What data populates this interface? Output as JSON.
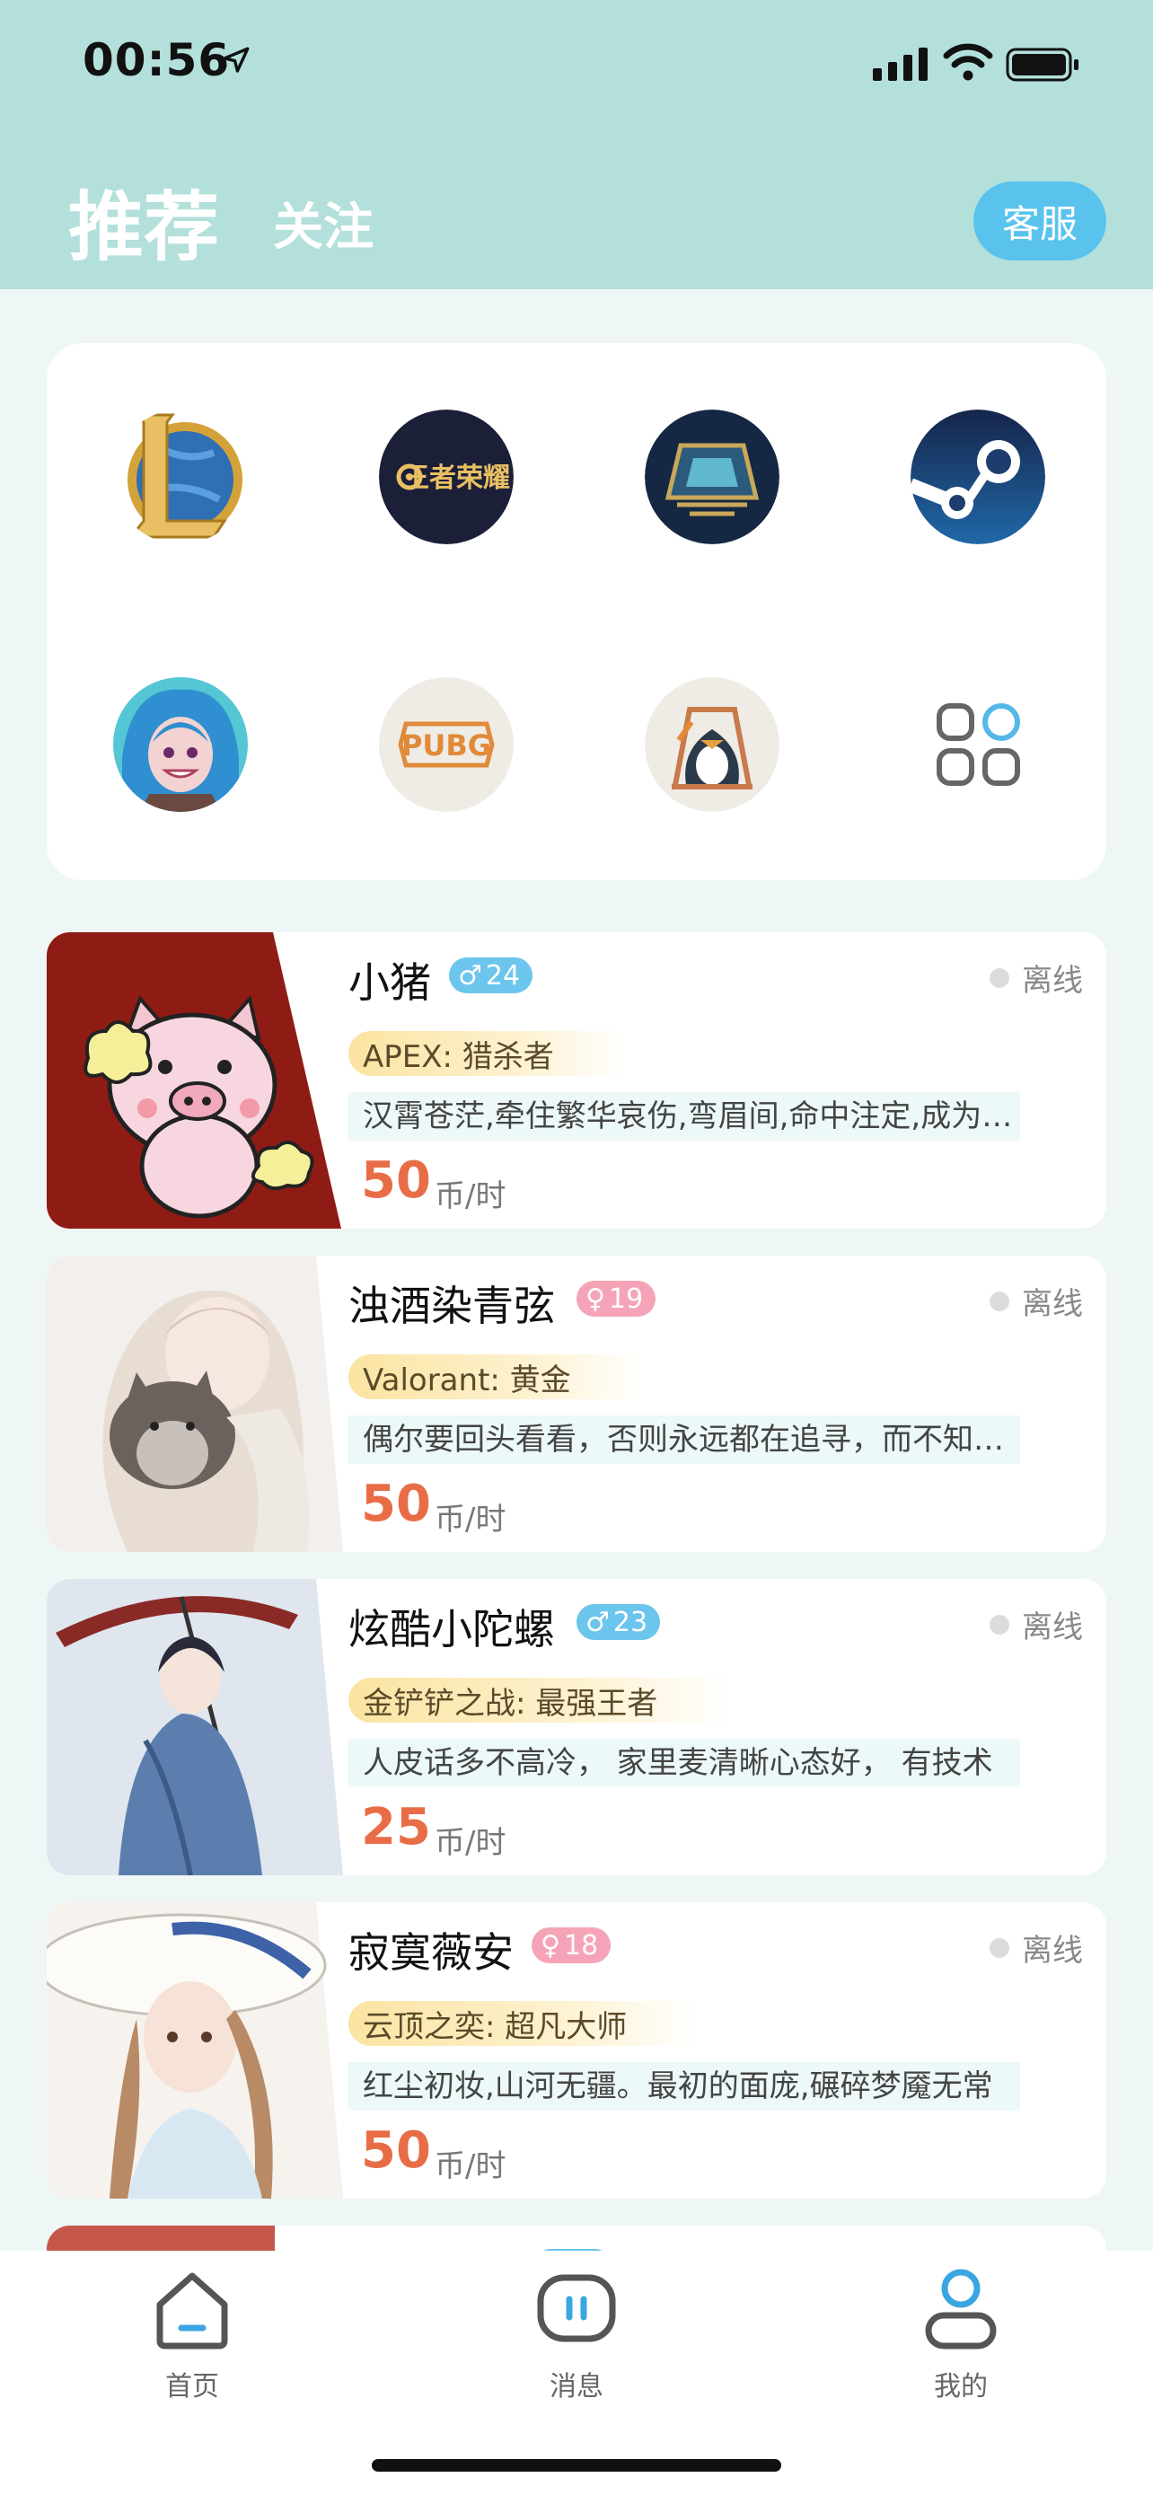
{
  "status_bar": {
    "time": "00:56"
  },
  "header": {
    "tab_recommend": "推荐",
    "tab_follow": "关注",
    "customer_service": "客服"
  },
  "games": [
    {
      "icon": "league-of-legends-icon"
    },
    {
      "icon": "honor-of-kings-icon",
      "text": "王者荣耀"
    },
    {
      "icon": "teamfight-tactics-icon"
    },
    {
      "icon": "steam-icon"
    },
    {
      "icon": "wild-rift-icon"
    },
    {
      "icon": "pubg-icon",
      "text": "PUBG"
    },
    {
      "icon": "penguin-game-icon"
    },
    {
      "icon": "more-apps-icon"
    }
  ],
  "players": [
    {
      "name": "小猪",
      "gender": "male",
      "gender_symbol": "♂",
      "age": "24",
      "status": "离线",
      "game_tag": "APEX:   猎杀者",
      "bio": "汉霄苍茫,牵住繁华哀伤,弯眉间,命中注定,成为过往",
      "price": "50",
      "unit": "币/时"
    },
    {
      "name": "浊酒染青弦",
      "gender": "female",
      "gender_symbol": "♀",
      "age": "19",
      "status": "离线",
      "game_tag": "Valorant:   黄金",
      "bio": "偶尔要回头看看，否则永远都在追寻，而不知道失去了什么",
      "price": "50",
      "unit": "币/时"
    },
    {
      "name": "炫酷小陀螺",
      "gender": "male",
      "gender_symbol": "♂",
      "age": "23",
      "status": "离线",
      "game_tag": "金铲铲之战:   最强王者",
      "bio": "人皮话多不高冷， 家里麦清晰心态好， 有技术",
      "price": "25",
      "unit": "币/时"
    },
    {
      "name": "寂寞薇安",
      "gender": "female",
      "gender_symbol": "♀",
      "age": "18",
      "status": "离线",
      "game_tag": "云顶之奕:   超凡大师",
      "bio": "红尘初妆,山河无疆。最初的面庞,碾碎梦魇无常",
      "price": "50",
      "unit": "币/时"
    }
  ],
  "tabbar": {
    "home": "首页",
    "messages": "消息",
    "mine": "我的"
  },
  "colors": {
    "header_bg": "#b4e0dc",
    "accent_blue": "#59c3ee",
    "price_orange": "#e86d46",
    "male": "#6cc5ec",
    "female": "#f5a4b8"
  }
}
